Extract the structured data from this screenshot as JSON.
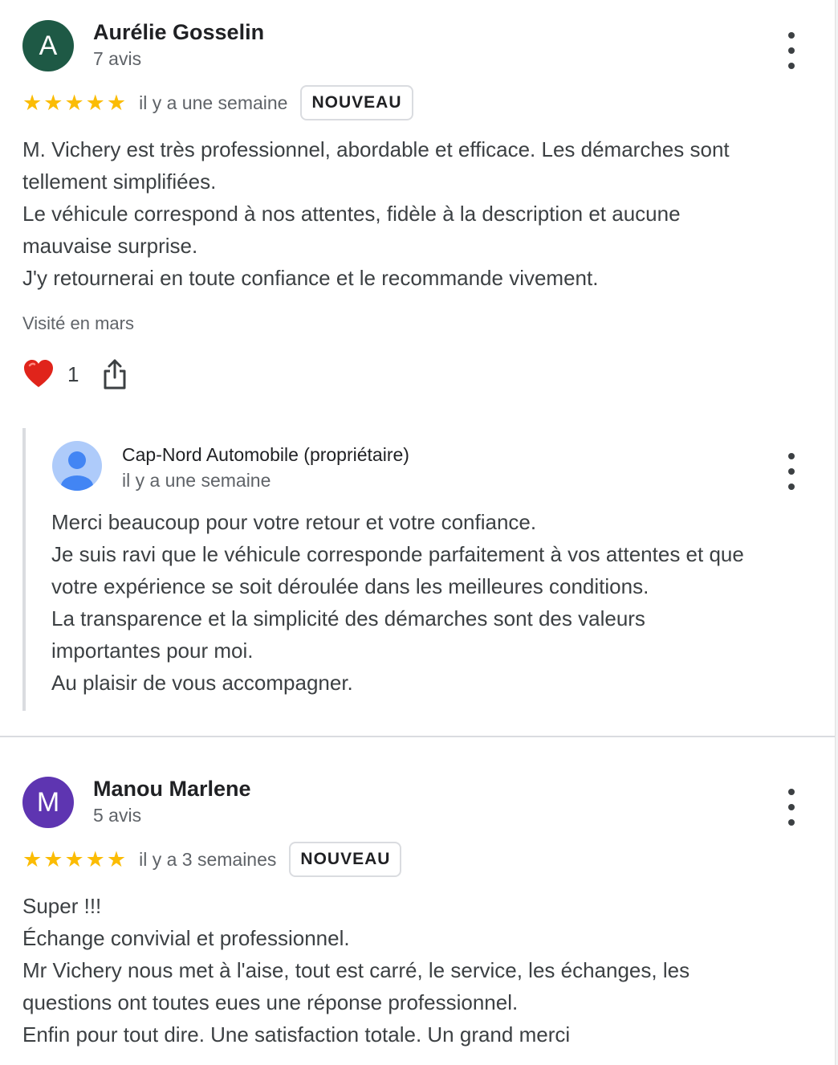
{
  "reviews": [
    {
      "avatar_letter": "A",
      "avatar_color": "#1e5945",
      "name": "Aurélie Gosselin",
      "review_count": "7 avis",
      "stars": 5,
      "time": "il y a une semaine",
      "badge": "NOUVEAU",
      "text_lines": [
        "M. Vichery est très professionnel, abordable et efficace. Les démarches sont",
        "tellement simplifiées.",
        "Le véhicule correspond à nos attentes, fidèle à la description et aucune",
        "mauvaise surprise.",
        "J'y retournerai en toute confiance et le recommande vivement."
      ],
      "visited": "Visité en mars",
      "likes": "1",
      "owner_reply": {
        "name": "Cap-Nord Automobile (propriétaire)",
        "time": "il y a une semaine",
        "text_lines": [
          "Merci beaucoup pour votre retour et votre confiance.",
          "Je suis ravi que le véhicule corresponde parfaitement à vos attentes et que",
          "votre expérience se soit déroulée dans les meilleures conditions.",
          "La transparence et la simplicité des démarches sont des valeurs",
          "importantes pour moi.",
          "Au plaisir de vous accompagner."
        ]
      }
    },
    {
      "avatar_letter": "M",
      "avatar_color": "#5e35b1",
      "name": "Manou Marlene",
      "review_count": "5 avis",
      "stars": 5,
      "time": "il y a 3 semaines",
      "badge": "NOUVEAU",
      "text_lines": [
        "Super !!!",
        "Échange convivial et professionnel.",
        "Mr Vichery nous met à l'aise, tout est carré, le service, les échanges, les",
        "questions ont toutes eues une réponse professionnel.",
        "Enfin pour tout dire. Une satisfaction totale. Un grand merci"
      ]
    }
  ],
  "icons": {
    "heart": "heart-icon",
    "share": "share-icon",
    "more": "more-vert-icon",
    "star": "star-icon"
  },
  "colors": {
    "star": "#fbbc04",
    "heart": "#e0241b"
  }
}
